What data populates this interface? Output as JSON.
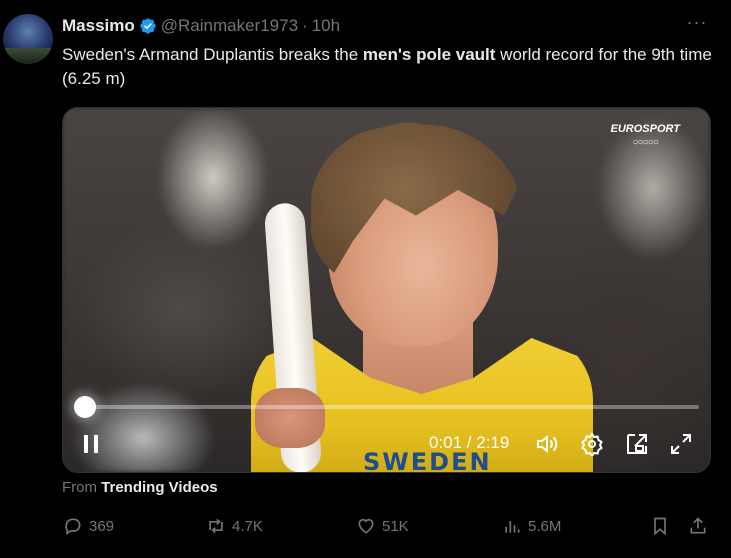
{
  "tweet": {
    "author_name": "Massimo",
    "handle": "@Rainmaker1973",
    "separator": "·",
    "time": "10h",
    "more": "···",
    "text_parts": [
      "Sweden's Armand Duplantis breaks the ",
      "men's pole vault",
      " world record for the 9th time (6.25 m)"
    ]
  },
  "video": {
    "watermark": "EUROSPORT",
    "watermark_rings": "○○○○○",
    "jersey_text": "SWEDEN",
    "time_readout": "0:01 / 2:19",
    "progress_fraction": 0.0072
  },
  "source": {
    "prefix": "From",
    "name": "Trending Videos"
  },
  "actions": {
    "replies": "369",
    "reposts": "4.7K",
    "likes": "51K",
    "views": "5.6M"
  },
  "colors": {
    "background": "#000000",
    "text": "#e7e9ea",
    "muted": "#71767b",
    "verified": "#1d9bf0",
    "jersey": "#f0cf35"
  }
}
